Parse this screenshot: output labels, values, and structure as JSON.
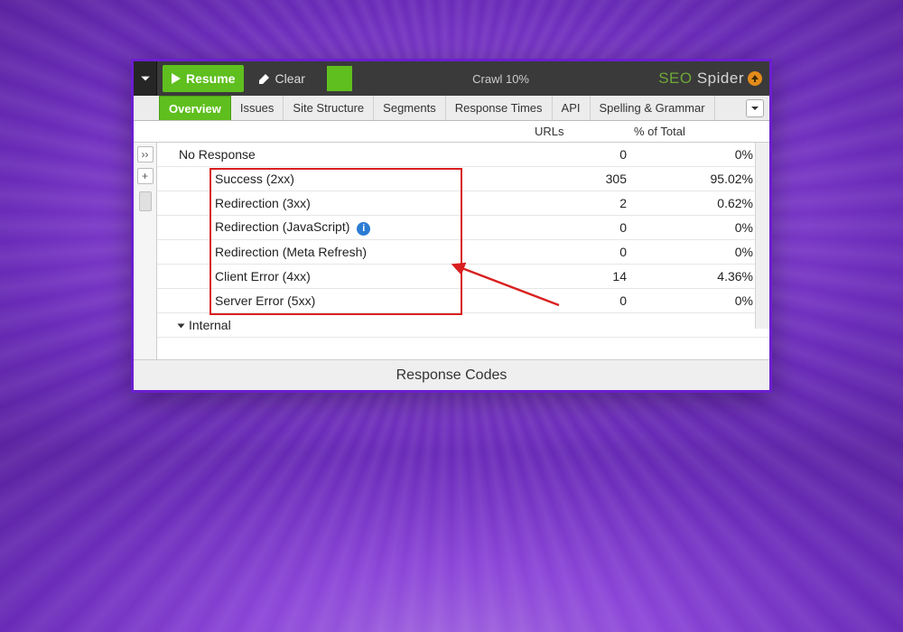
{
  "toolbar": {
    "resume_label": "Resume",
    "clear_label": "Clear",
    "crawl_status": "Crawl 10%"
  },
  "brand": {
    "part1": "SEO",
    "part2": " Spider"
  },
  "tabs": [
    {
      "label": "Overview"
    },
    {
      "label": "Issues"
    },
    {
      "label": "Site Structure"
    },
    {
      "label": "Segments"
    },
    {
      "label": "Response Times"
    },
    {
      "label": "API"
    },
    {
      "label": "Spelling & Grammar"
    }
  ],
  "columns": {
    "urls": "URLs",
    "pct": "% of Total"
  },
  "rows": [
    {
      "label": "No Response",
      "urls": "0",
      "pct": "0%",
      "indent": false
    },
    {
      "label": "Success (2xx)",
      "urls": "305",
      "pct": "95.02%",
      "indent": true
    },
    {
      "label": "Redirection (3xx)",
      "urls": "2",
      "pct": "0.62%",
      "indent": true
    },
    {
      "label": "Redirection (JavaScript)",
      "urls": "0",
      "pct": "0%",
      "indent": true,
      "info": true
    },
    {
      "label": "Redirection (Meta Refresh)",
      "urls": "0",
      "pct": "0%",
      "indent": true
    },
    {
      "label": "Client Error (4xx)",
      "urls": "14",
      "pct": "4.36%",
      "indent": true
    },
    {
      "label": "Server Error (5xx)",
      "urls": "0",
      "pct": "0%",
      "indent": true
    }
  ],
  "group_label": "Internal",
  "footer_title": "Response Codes",
  "colors": {
    "accent": "#5fbf1e",
    "annotation": "#d92020"
  }
}
